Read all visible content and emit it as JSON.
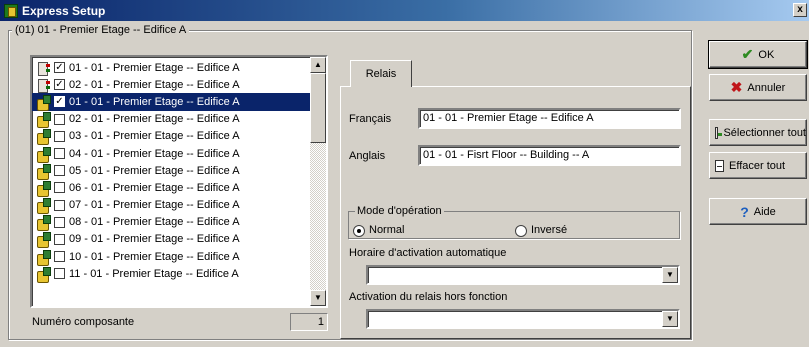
{
  "window": {
    "title": "Express Setup",
    "close_glyph": "x"
  },
  "group": {
    "title": "(01) 01 - Premier Etage -- Edifice A"
  },
  "list": {
    "items": [
      {
        "icon": "panel-icon",
        "checked": "✓",
        "label": "01 - 01 - Premier Etage -- Edifice A"
      },
      {
        "icon": "panel-icon",
        "checked": "✓",
        "label": "02 - 01 - Premier Etage -- Edifice A"
      },
      {
        "icon": "relay-hand-icon",
        "checked": "✓",
        "label": "01 - 01 - Premier Etage -- Edifice A"
      },
      {
        "icon": "relay-hand-icon",
        "checked": "",
        "label": "02 - 01 - Premier Etage -- Edifice A"
      },
      {
        "icon": "relay-hand-icon",
        "checked": "",
        "label": "03 - 01 - Premier Etage -- Edifice A"
      },
      {
        "icon": "relay-hand-icon",
        "checked": "",
        "label": "04 - 01 - Premier Etage -- Edifice A"
      },
      {
        "icon": "relay-hand-icon",
        "checked": "",
        "label": "05 - 01 - Premier Etage -- Edifice A"
      },
      {
        "icon": "relay-hand-icon",
        "checked": "",
        "label": "06 - 01 - Premier Etage -- Edifice A"
      },
      {
        "icon": "relay-hand-icon",
        "checked": "",
        "label": "07 - 01 - Premier Etage -- Edifice A"
      },
      {
        "icon": "relay-hand-icon",
        "checked": "",
        "label": "08 - 01 - Premier Etage -- Edifice A"
      },
      {
        "icon": "relay-hand-icon",
        "checked": "",
        "label": "09 - 01 - Premier Etage -- Edifice A"
      },
      {
        "icon": "relay-hand-icon",
        "checked": "",
        "label": "10 - 01 - Premier Etage -- Edifice A"
      },
      {
        "icon": "relay-hand-icon",
        "checked": "",
        "label": "11 - 01 - Premier Etage -- Edifice A"
      }
    ],
    "selected_index": 2,
    "scroll_up_glyph": "▲",
    "scroll_down_glyph": "▼"
  },
  "component": {
    "label": "Numéro composante",
    "value": "1"
  },
  "tabs": [
    {
      "label": "Relais"
    }
  ],
  "relay": {
    "french_label": "Français",
    "french_value": "01 - 01 - Premier Etage -- Edifice A",
    "english_label": "Anglais",
    "english_value": "01 - 01 - Fisrt Floor -- Building -- A",
    "mode_title": "Mode d'opération",
    "mode_normal": "Normal",
    "mode_inverse": "Inversé",
    "schedule_label": "Horaire d'activation automatique",
    "schedule_value": "",
    "offline_label": "Activation du relais hors fonction",
    "offline_value": "",
    "dropdown_glyph": "▼"
  },
  "buttons": {
    "ok": "OK",
    "cancel": "Annuler",
    "select_all": "Sélectionner tout",
    "clear_all": "Effacer tout",
    "help": "Aide"
  },
  "icons": {
    "ok": "✔",
    "cancel": "✖",
    "help": "?"
  },
  "colors": {
    "selection": "#0a246a",
    "titlebar": "#0a246a",
    "face": "#d4d0c8"
  }
}
